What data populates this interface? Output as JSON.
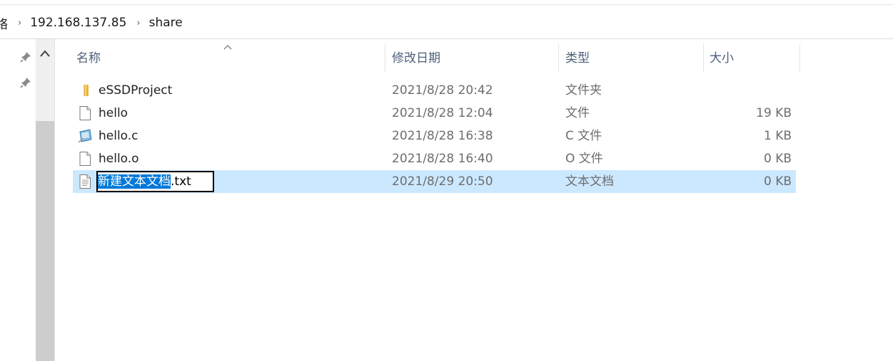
{
  "breadcrumb": {
    "items": [
      "络",
      "192.168.137.85",
      "share"
    ],
    "separator": "›"
  },
  "columns": {
    "name": "名称",
    "date": "修改日期",
    "type": "类型",
    "size": "大小"
  },
  "files": [
    {
      "name": "eSSDProject",
      "date": "2021/8/28 20:42",
      "type": "文件夹",
      "size": "",
      "icon": "folder-icon"
    },
    {
      "name": "hello",
      "date": "2021/8/28 12:04",
      "type": "文件",
      "size": "19 KB",
      "icon": "file-icon"
    },
    {
      "name": "hello.c",
      "date": "2021/8/28 16:38",
      "type": "C 文件",
      "size": "1 KB",
      "icon": "c-file-icon"
    },
    {
      "name": "hello.o",
      "date": "2021/8/28 16:40",
      "type": "O 文件",
      "size": "0 KB",
      "icon": "file-icon"
    },
    {
      "name": "新建文本文档.txt",
      "date": "2021/8/29 20:50",
      "type": "文本文档",
      "size": "0 KB",
      "icon": "text-file-icon"
    }
  ],
  "rename": {
    "selected_text": "新建文本文档",
    "rest_text": ".txt"
  },
  "colors": {
    "selection_row": "#cce8ff",
    "selection_text": "#0078d7",
    "header_text": "#4c607a"
  }
}
